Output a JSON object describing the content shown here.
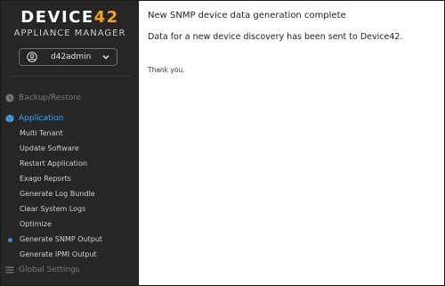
{
  "brand": {
    "logo_main": "DEVICE",
    "logo_accent": "42",
    "subtitle": "APPLIANCE MANAGER",
    "accent_color": "#f2a51a"
  },
  "user_menu": {
    "username": "d42admin",
    "icon": "user-circle-icon",
    "chevron": "chevron-down-icon"
  },
  "sidebar": {
    "sections": [
      {
        "label": "Backup/Restore",
        "icon": "backup-icon",
        "active": false
      },
      {
        "label": "Application",
        "icon": "cube-icon",
        "active": true
      },
      {
        "label": "Global Settings",
        "icon": "list-icon",
        "active": false
      }
    ],
    "application_items": [
      {
        "label": "Multi Tenant",
        "selected": false
      },
      {
        "label": "Update Software",
        "selected": false
      },
      {
        "label": "Restart Application",
        "selected": false
      },
      {
        "label": "Exago Reports",
        "selected": false
      },
      {
        "label": "Generate Log Bundle",
        "selected": false
      },
      {
        "label": "Clear System Logs",
        "selected": false
      },
      {
        "label": "Optimize",
        "selected": false
      },
      {
        "label": "Generate SNMP Output",
        "selected": true
      },
      {
        "label": "Generate IPMI Output",
        "selected": false
      }
    ],
    "active_color": "#4aa3e8",
    "background": "#262626"
  },
  "main": {
    "title": "New SNMP device data generation complete",
    "message": "Data for a new device discovery has been sent to Device42.",
    "thanks": "Thank you."
  }
}
